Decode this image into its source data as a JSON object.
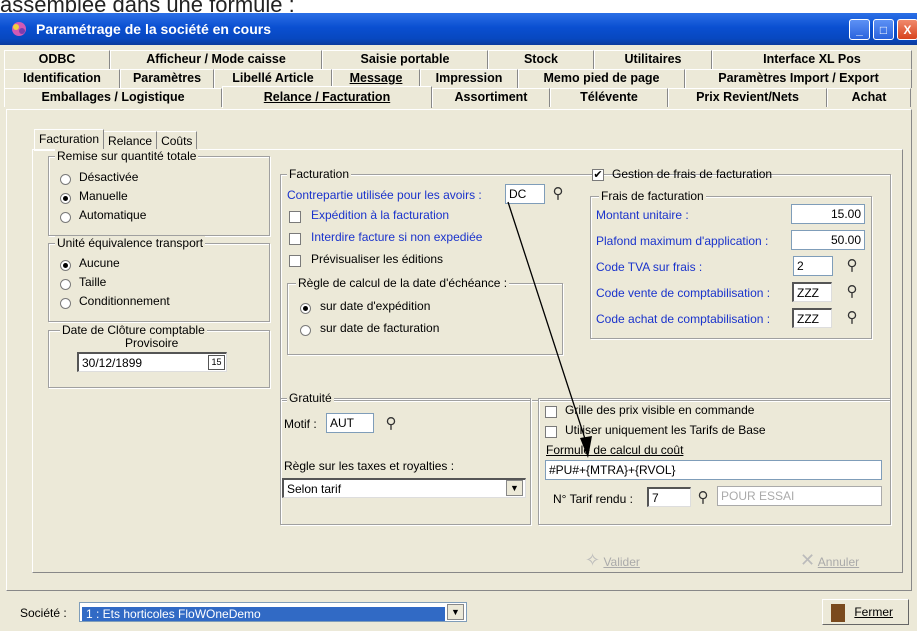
{
  "caption": "assemblée dans une formule :",
  "window": {
    "title": "Paramétrage de la société en cours"
  },
  "tabs_row1": [
    "ODBC",
    "Afficheur / Mode caisse",
    "Saisie portable",
    "Stock",
    "Utilitaires",
    "Interface XL Pos"
  ],
  "tabs_row2": [
    "Identification",
    "Paramètres",
    "Libellé Article",
    "Message",
    "Impression",
    "Memo pied de page",
    "Paramètres Import / Export"
  ],
  "tabs_row3": [
    "Emballages / Logistique",
    "Relance / Facturation",
    "Assortiment",
    "Télévente",
    "Prix Revient/Nets",
    "Achat"
  ],
  "subtabs": [
    "Facturation",
    "Relance",
    "Coûts"
  ],
  "remise": {
    "title": "Remise sur quantité totale",
    "options": [
      "Désactivée",
      "Manuelle",
      "Automatique"
    ],
    "selected": "Manuelle"
  },
  "unite": {
    "title": "Unité équivalence transport",
    "options": [
      "Aucune",
      "Taille",
      "Conditionnement"
    ],
    "selected": "Aucune"
  },
  "cloture": {
    "title_line1": "Date de Clôture comptable",
    "title_line2": "Provisoire",
    "value": "30/12/1899",
    "cal_label": "15"
  },
  "facturation": {
    "title": "Facturation",
    "contrepartie_label": "Contrepartie utilisée pour les avoirs :",
    "contrepartie_value": "DC",
    "chk_expedition": "Expédition à la facturation",
    "chk_interdire": "Interdire facture si non expediée",
    "chk_previsualiser": "Prévisualiser les éditions",
    "regle_title": "Règle de calcul de la date d'échéance :",
    "regle_options": [
      "sur date d'expédition",
      "sur date de facturation"
    ],
    "regle_selected": "sur date d'expédition"
  },
  "frais": {
    "gestion_label": "Gestion de frais de facturation",
    "gestion_checked": true,
    "title": "Frais de facturation",
    "montant_label": "Montant unitaire :",
    "montant_value": "15.00",
    "plafond_label": "Plafond maximum d'application :",
    "plafond_value": "50.00",
    "tva_label": "Code TVA sur frais :",
    "tva_value": "2",
    "vente_label": "Code vente de comptabilisation :",
    "vente_value": "ZZZ",
    "achat_label": "Code achat de comptabilisation :",
    "achat_value": "ZZZ"
  },
  "gratuite": {
    "title": "Gratuité",
    "motif_label": "Motif :",
    "motif_value": "AUT",
    "taxes_label": "Règle sur les taxes et royalties :",
    "taxes_value": "Selon tarif"
  },
  "cout": {
    "chk_grille": "Grille des prix visible en commande",
    "chk_utiliser": "Utiliser uniquement les Tarifs de Base",
    "formule_label": "Formule de calcul du coût",
    "formule_value": "#PU#+{MTRA}+{RVOL}",
    "tarif_label": "N° Tarif rendu :",
    "tarif_value": "7",
    "tarif_desc": "POUR ESSAI"
  },
  "buttons": {
    "valider": "Valider",
    "annuler": "Annuler",
    "fermer": "Fermer"
  },
  "societe": {
    "label": "Société :",
    "value": "1 : Ets horticoles FloWOneDemo"
  },
  "colors": {
    "titlebar": "#0a4fd1",
    "face": "#ece9d8",
    "link_blue": "#1a33cc",
    "select_blue": "#316ac5"
  }
}
